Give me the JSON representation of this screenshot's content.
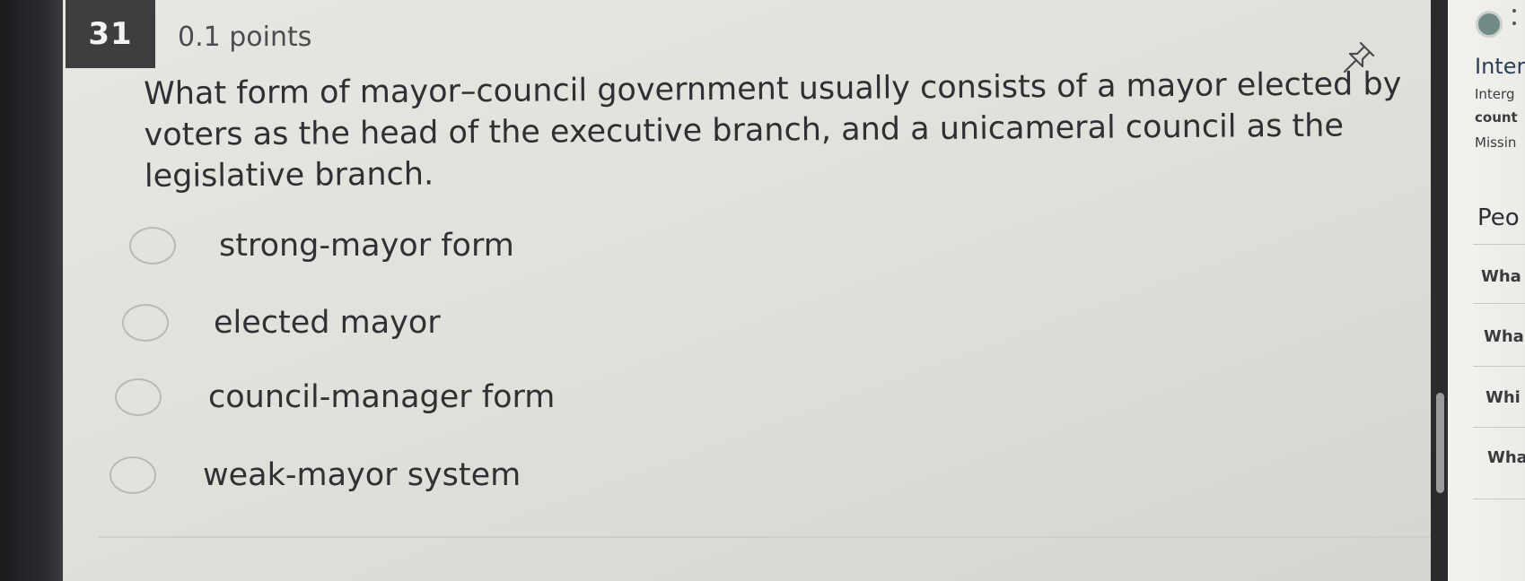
{
  "question": {
    "number": "31",
    "points": "0.1 points",
    "text": "What form of mayor–council government usually consists of a mayor elected by voters as the head of the executive branch, and a unicameral council as the legislative branch.",
    "pin_icon": "pin-icon"
  },
  "options": [
    {
      "label": "strong-mayor form"
    },
    {
      "label": "elected mayor"
    },
    {
      "label": "council-manager form"
    },
    {
      "label": "weak-mayor system"
    }
  ],
  "sidebar": {
    "title": "Inter",
    "sub_lines": [
      "Interg",
      "count",
      "Missin"
    ],
    "heading": "Peo",
    "items": [
      "Wha",
      "Wha",
      "Whi",
      "Wha"
    ]
  },
  "colors": {
    "panel_bg": "#e3e3de",
    "badge_bg": "#3d3e40",
    "text": "#2f3033",
    "sidebar_title": "#2c3e58"
  }
}
